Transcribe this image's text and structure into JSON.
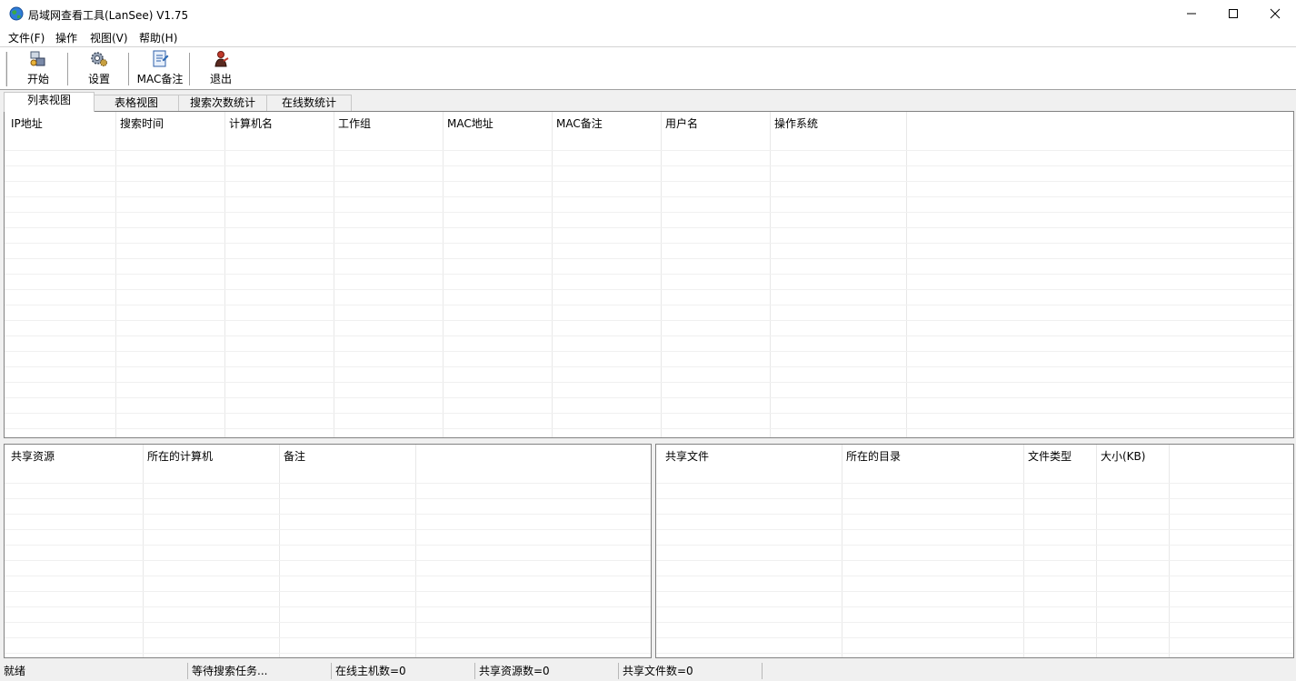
{
  "window": {
    "title": "局域网查看工具(LanSee) V1.75"
  },
  "menu": [
    "文件(F)",
    "操作",
    "视图(V)",
    "帮助(H)"
  ],
  "toolbar": {
    "start_label": "开始",
    "settings_label": "设置",
    "mac_note_label": "MAC备注",
    "exit_label": "退出"
  },
  "tabs": [
    "列表视图",
    "表格视图",
    "搜索次数统计",
    "在线数统计"
  ],
  "main_table": {
    "columns": [
      "IP地址",
      "搜索时间",
      "计算机名",
      "工作组",
      "MAC地址",
      "MAC备注",
      "用户名",
      "操作系统"
    ]
  },
  "share_table": {
    "columns": [
      "共享资源",
      "所在的计算机",
      "备注"
    ]
  },
  "file_table": {
    "columns": [
      "共享文件",
      "所在的目录",
      "文件类型",
      "大小(KB)"
    ]
  },
  "status": [
    "就绪",
    "等待搜索任务...",
    "在线主机数=0",
    "共享资源数=0",
    "共享文件数=0"
  ],
  "colors": {
    "accent": "#1e6fd8",
    "exit_red": "#c0392b"
  }
}
